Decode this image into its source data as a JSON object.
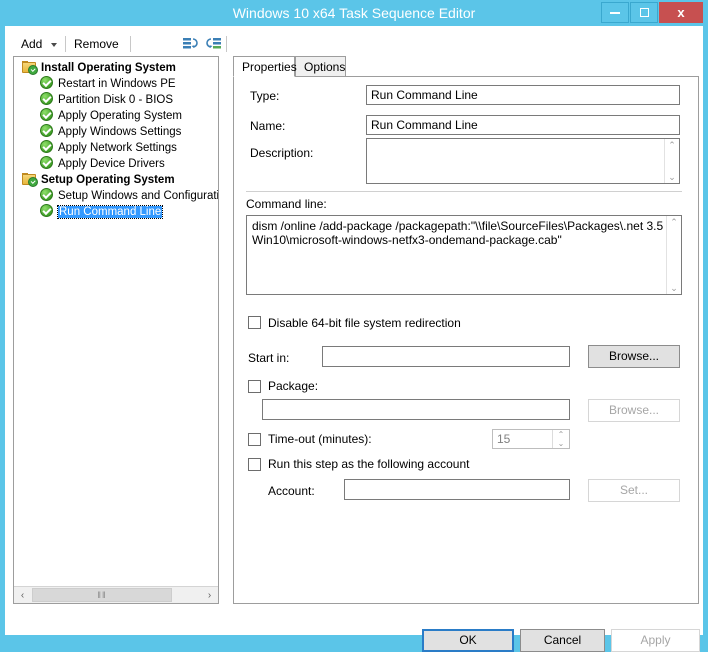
{
  "window": {
    "title": "Windows 10 x64 Task Sequence Editor",
    "minimize_label": "Minimize",
    "maximize_label": "Maximize",
    "close_label": "x",
    "titlebar_color": "#5bc5e8",
    "close_color": "#c75050"
  },
  "toolbar": {
    "add_label": "Add",
    "remove_label": "Remove",
    "icon1_name": "insert-step-icon",
    "icon2_name": "insert-group-icon"
  },
  "tree": {
    "items": [
      {
        "label": "Install Operating System",
        "type": "group",
        "icon": "folder-check-icon",
        "selected": false
      },
      {
        "label": "Restart in Windows PE",
        "type": "child",
        "icon": "green-check-icon",
        "selected": false
      },
      {
        "label": "Partition Disk 0 - BIOS",
        "type": "child",
        "icon": "green-check-icon",
        "selected": false
      },
      {
        "label": "Apply Operating System",
        "type": "child",
        "icon": "green-check-icon",
        "selected": false
      },
      {
        "label": "Apply Windows Settings",
        "type": "child",
        "icon": "green-check-icon",
        "selected": false
      },
      {
        "label": "Apply Network Settings",
        "type": "child",
        "icon": "green-check-icon",
        "selected": false
      },
      {
        "label": "Apply Device Drivers",
        "type": "child",
        "icon": "green-check-icon",
        "selected": false
      },
      {
        "label": "Setup Operating System",
        "type": "group",
        "icon": "folder-check-icon",
        "selected": false
      },
      {
        "label": "Setup Windows and Configuration",
        "type": "child",
        "icon": "green-check-icon",
        "selected": false
      },
      {
        "label": "Run Command Line",
        "type": "child",
        "icon": "green-check-icon",
        "selected": true
      }
    ],
    "scroll_left_glyph": "‹",
    "scroll_right_glyph": "›",
    "scroll_thumb_glyph": "‖‖"
  },
  "tabs": [
    {
      "label": "Properties",
      "active": true
    },
    {
      "label": "Options",
      "active": false
    }
  ],
  "properties": {
    "type_label": "Type:",
    "type_value": "Run Command Line",
    "name_label": "Name:",
    "name_value": "Run Command Line",
    "description_label": "Description:",
    "description_value": "",
    "command_line_label": "Command line:",
    "command_line_value": "dism /online /add-package /packagepath:\"\\\\file\\SourceFiles\\Packages\\.net 3.5 Win10\\microsoft-windows-netfx3-ondemand-package.cab\"",
    "disable_redirection_label": "Disable 64-bit file system redirection",
    "disable_redirection_checked": false,
    "start_in_label": "Start in:",
    "start_in_value": "",
    "start_in_browse_label": "Browse...",
    "package_label": "Package:",
    "package_checked": false,
    "package_value": "",
    "package_browse_label": "Browse...",
    "timeout_label": "Time-out (minutes):",
    "timeout_checked": false,
    "timeout_value": "15",
    "run_as_label": "Run this step as the following account",
    "run_as_checked": false,
    "account_label": "Account:",
    "account_value": "",
    "account_set_label": "Set...",
    "spin_up_glyph": "⌃",
    "spin_down_glyph": "⌄",
    "scroll_up_glyph": "⌃",
    "scroll_down_glyph": "⌄"
  },
  "footer": {
    "ok_label": "OK",
    "cancel_label": "Cancel",
    "apply_label": "Apply"
  }
}
